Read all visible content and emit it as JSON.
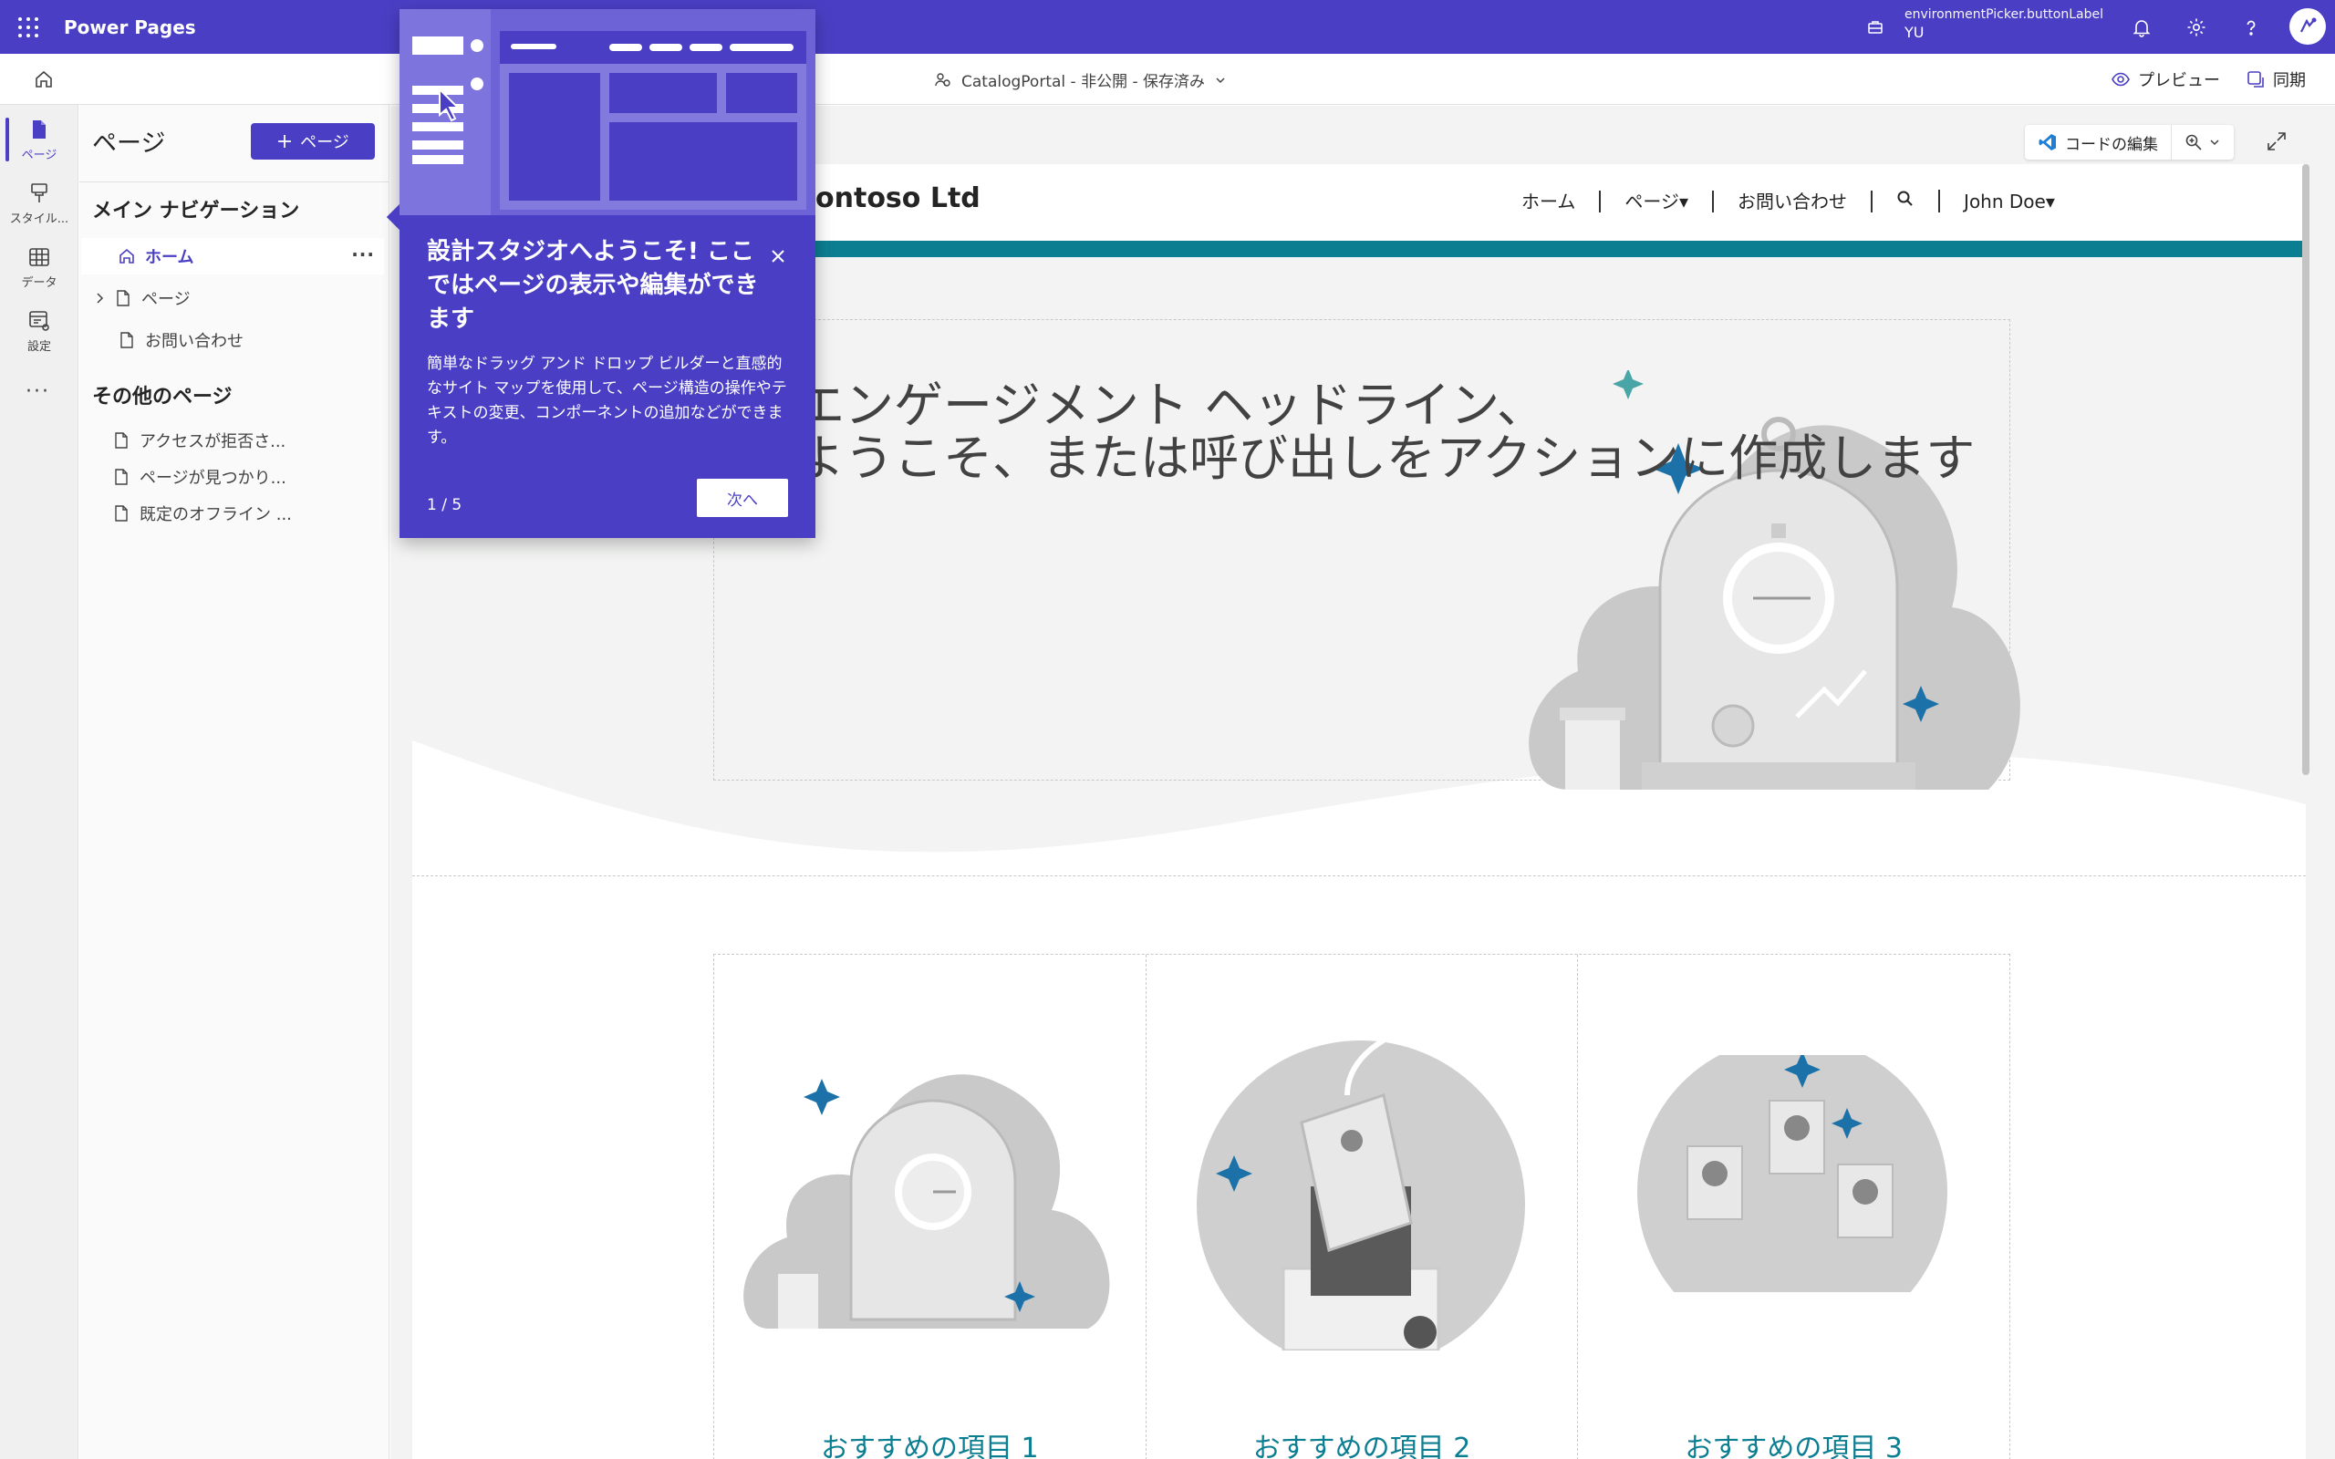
{
  "topbar": {
    "app_title": "Power Pages",
    "environment_label": "environmentPicker.buttonLabel",
    "environment_value": "YU"
  },
  "subbar": {
    "site_status": "CatalogPortal - 非公開 - 保存済み",
    "preview_label": "プレビュー",
    "sync_label": "同期"
  },
  "rail": {
    "items": [
      {
        "label": "ページ"
      },
      {
        "label": "スタイル..."
      },
      {
        "label": "データ"
      },
      {
        "label": "設定"
      }
    ],
    "more": "···"
  },
  "pages_panel": {
    "title": "ページ",
    "add_button": "ページ",
    "main_nav_heading": "メイン ナビゲーション",
    "main_nav_items": [
      {
        "label": "ホーム"
      },
      {
        "label": "ページ"
      },
      {
        "label": "お問い合わせ"
      }
    ],
    "more_dots": "···",
    "other_heading": "その他のページ",
    "other_items": [
      {
        "label": "アクセスが拒否さ..."
      },
      {
        "label": "ページが見つかり..."
      },
      {
        "label": "既定のオフライン ..."
      }
    ]
  },
  "canvas": {
    "code_edit_label": "コードの編集"
  },
  "site": {
    "name": "Contoso Ltd",
    "nav": [
      {
        "label": "ホーム"
      },
      {
        "label": "ページ▾"
      },
      {
        "label": "お問い合わせ"
      },
      {
        "label": "John Doe▾"
      }
    ],
    "hero_line1": "エンゲージメント ヘッドライン、",
    "hero_line2": "ようこそ、または呼び出しをアクションに作成します",
    "cards": [
      {
        "title": "おすすめの項目 1"
      },
      {
        "title": "おすすめの項目 2"
      },
      {
        "title": "おすすめの項目 3"
      }
    ]
  },
  "teaching_bubble": {
    "title": "設計スタジオへようこそ! ここではページの表示や編集ができます",
    "body": "簡単なドラッグ アンド ドロップ ビルダーと直感的なサイト マップを使用して、ページ構造の操作やテキストの変更、コンポーネントの追加などができます。",
    "step": "1 / 5",
    "next_label": "次へ"
  },
  "colors": {
    "brand": "#4a3fc4",
    "teal": "#0c7e92"
  }
}
